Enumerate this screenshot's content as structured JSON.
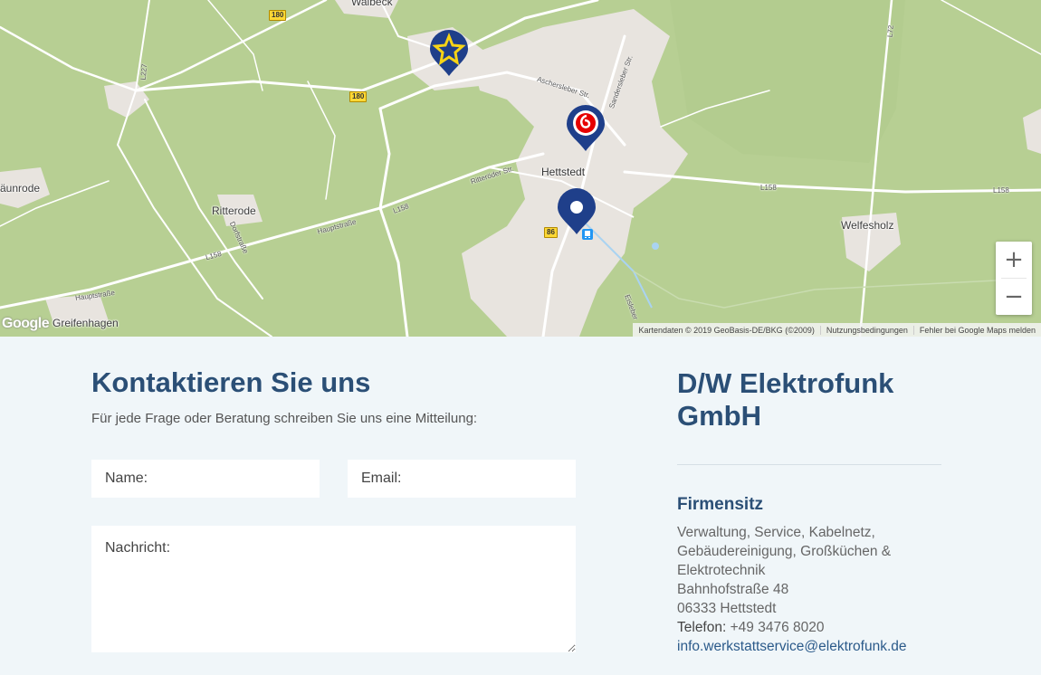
{
  "map": {
    "places": [
      "Walbeck",
      "Hettstedt",
      "Ritterode",
      "Welfesholz",
      "äunrode",
      "Greifenhagen"
    ],
    "roads": [
      "Aschersleber Str.",
      "Sandersleber Str.",
      "Ritteröder Str.",
      "Hauptstraße",
      "L158",
      "L158",
      "L158",
      "L158",
      "Dorfstraße",
      "Hauptstraße",
      "Eisleber",
      "L227",
      "L72"
    ],
    "shields": [
      "180",
      "180",
      "86"
    ],
    "markers": [
      "star-marker-icon",
      "vodafone-marker-icon",
      "location-pin-icon"
    ],
    "zoom_in": "+",
    "zoom_out": "−",
    "google_logo": "Google",
    "attribution": [
      "Kartendaten © 2019 GeoBasis-DE/BKG (©2009)",
      "Nutzungsbedingungen",
      "Fehler bei Google Maps melden"
    ]
  },
  "contact": {
    "title": "Kontaktieren Sie uns",
    "subtitle": "Für jede Frage oder Beratung schreiben Sie uns eine Mitteilung:",
    "name_placeholder": "Name:",
    "email_placeholder": "Email:",
    "message_placeholder": "Nachricht:"
  },
  "company": {
    "name": "D/W Elektrofunk GmbH",
    "hq_title": "Firmensitz",
    "services": "Verwaltung, Service, Kabelnetz, Gebäudereinigung, Großküchen & Elektrotechnik",
    "street": "Bahnhofstraße 48",
    "city": "06333 Hettstedt",
    "phone_label": "Telefon:",
    "phone": "+49 3476 8020",
    "email": "info.werkstattservice@elektrofunk.de"
  },
  "colors": {
    "heading": "#2b4f76",
    "pin": "#1f4a93",
    "background": "#f0f6f9"
  }
}
